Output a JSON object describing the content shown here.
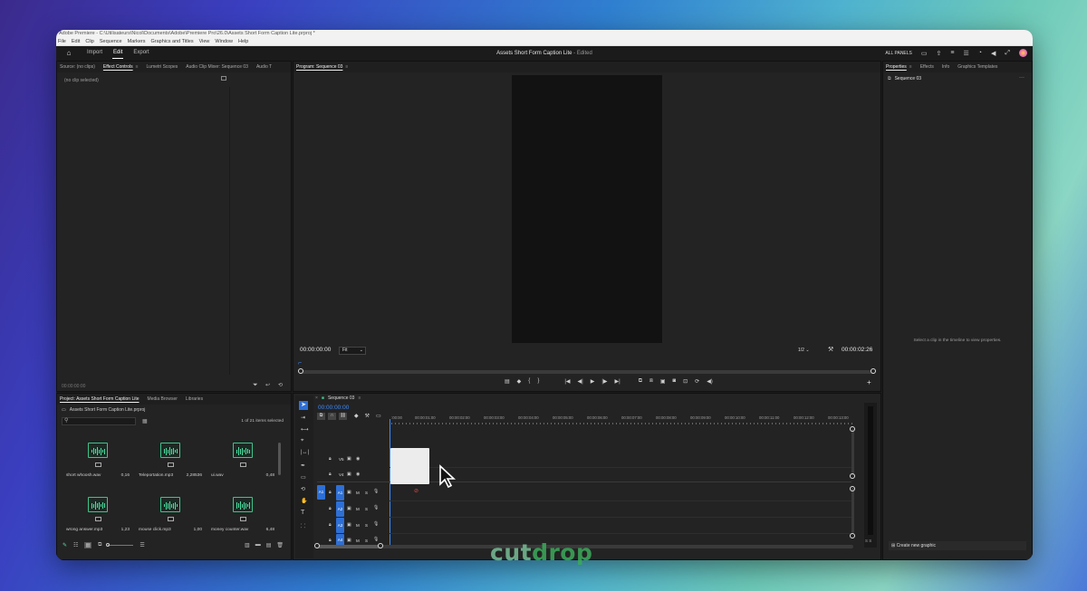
{
  "window": {
    "title": "Adobe Premiere - C:\\Utilisateurs\\Nicol\\Documents\\Adobe\\Premiere Pro\\26.0\\Assets Short Form Caption Lite.prproj *",
    "menu": [
      "File",
      "Edit",
      "Clip",
      "Sequence",
      "Markers",
      "Graphics and Titles",
      "View",
      "Window",
      "Help"
    ]
  },
  "header": {
    "workspaces": [
      "Import",
      "Edit",
      "Export"
    ],
    "active_workspace": "Edit",
    "project_title": "Assets Short Form Caption Lite",
    "status": "- Edited",
    "all_panels": "ALL PANELS"
  },
  "source_panel": {
    "tabs": [
      "Source: (no clips)",
      "Effect Controls",
      "Lumetri Scopes",
      "Audio Clip Mixer: Sequence 03",
      "Audio T"
    ],
    "active_tab": "Effect Controls",
    "no_clip": "(no clip selected)",
    "timecode": "00:00:00:00"
  },
  "program_panel": {
    "tab": "Program: Sequence 03",
    "timecode_left": "00:00:00:00",
    "fit": "Fit",
    "resolution": "1/2",
    "timecode_right": "00:00:02:26"
  },
  "properties_panel": {
    "tabs": [
      "Properties",
      "Effects",
      "Info",
      "Graphics Templates"
    ],
    "active_tab": "Properties",
    "sequence": "Sequence 03",
    "hint": "Select a clip in the timeline to view properties.",
    "create_graphic": "Create new graphic"
  },
  "project_panel": {
    "tabs": [
      "Project: Assets Short Form Caption Lite",
      "Media Browser",
      "Libraries"
    ],
    "active_tab": "Project: Assets Short Form Caption Lite",
    "file": "Assets Short Form Caption Lite.prproj",
    "selected_count": "1 of 21 items selected",
    "items": [
      {
        "name": "short whoosh.wav",
        "duration": "0,16"
      },
      {
        "name": "Teleportation.mp3",
        "duration": "2,28536"
      },
      {
        "name": "ui.wav",
        "duration": "0,48"
      },
      {
        "name": "wrong answer.mp3",
        "duration": "1,23"
      },
      {
        "name": "mouse click.mp3",
        "duration": "1,00"
      },
      {
        "name": "money counter.wav",
        "duration": "6,48"
      }
    ]
  },
  "timeline": {
    "tab": "Sequence 03",
    "timecode": "00:00:00:00",
    "ruler": [
      ":00:00",
      "00:00:01:00",
      "00:00:02:00",
      "00:00:03:00",
      "00:00:04:00",
      "00:00:05:00",
      "00:00:06:00",
      "00:00:07:00",
      "00:00:08:00",
      "00:00:09:00",
      "00:00:10:00",
      "00:00:11:00",
      "00:00:12:00",
      "00:00:13:00"
    ],
    "video_tracks": [
      "V5",
      "V4"
    ],
    "audio_tracks": [
      "A1",
      "A2",
      "A3",
      "A4"
    ],
    "source_patch": "A1",
    "mute_label": "M",
    "solo_label": "S"
  },
  "meter": {
    "labels": "S S"
  },
  "watermark": {
    "part1": "cut",
    "part2": "drop"
  }
}
